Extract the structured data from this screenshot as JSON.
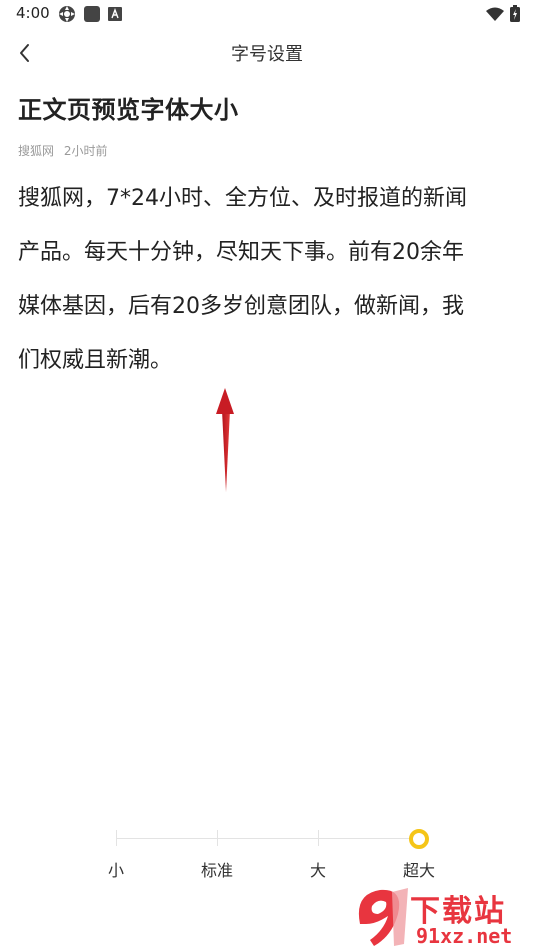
{
  "status_bar": {
    "time": "4:00",
    "left_icons": [
      "settings-icon",
      "square-app-icon",
      "a-icon"
    ],
    "right_icons": [
      "wifi-icon",
      "battery-icon"
    ]
  },
  "nav": {
    "title": "字号设置",
    "back_icon": "chevron-left-icon"
  },
  "article": {
    "title": "正文页预览字体大小",
    "source": "搜狐网",
    "time": "2小时前",
    "lines": [
      "搜狐网，7*24小时、全方位、及时报道的新闻",
      "产品。每天十分钟，尽知天下事。前有20余年",
      "媒体基因，后有20多岁创意团队，做新闻，我",
      "们权威且新潮。"
    ]
  },
  "font_size_slider": {
    "options": [
      "小",
      "标准",
      "大",
      "超大"
    ],
    "selected": "超大",
    "selected_index": 3,
    "accent_color": "#f5c518"
  },
  "watermark": {
    "brand": "下载站",
    "url": "91xz.net",
    "color": "#e8353f"
  }
}
